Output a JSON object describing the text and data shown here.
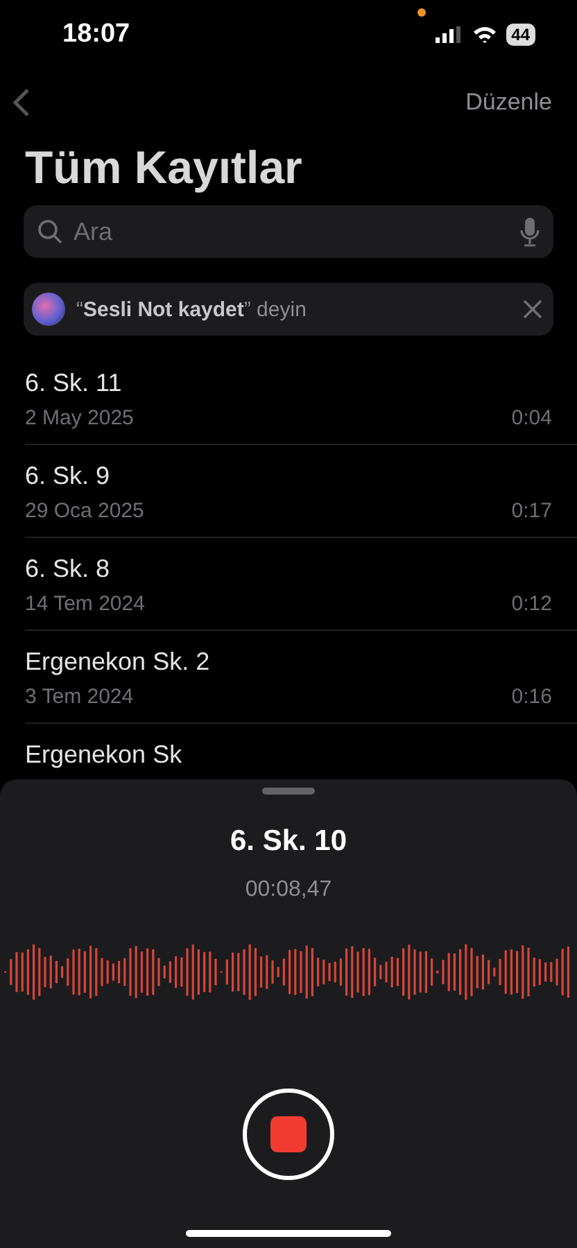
{
  "status_bar": {
    "time": "18:07",
    "battery": "44",
    "recording_dot": true
  },
  "nav": {
    "edit": "Düzenle"
  },
  "title": "Tüm Kayıtlar",
  "search": {
    "placeholder": "Ara"
  },
  "siri_tip": {
    "text": "“**Sesli Not kaydet**” deyin"
  },
  "recordings": [
    {
      "name": "6. Sk. 11",
      "date": "2 May 2025",
      "duration": "0:04"
    },
    {
      "name": "6. Sk. 9",
      "date": "29 Oca 2025",
      "duration": "0:17"
    },
    {
      "name": "6. Sk. 8",
      "date": "14 Tem 2024",
      "duration": "0:12"
    },
    {
      "name": "Ergenekon Sk. 2",
      "date": "3 Tem 2024",
      "duration": "0:16"
    },
    {
      "name": "Ergenekon Sk"
    }
  ],
  "recorder": {
    "name": "6. Sk. 10",
    "elapsed": "00:08,47"
  }
}
